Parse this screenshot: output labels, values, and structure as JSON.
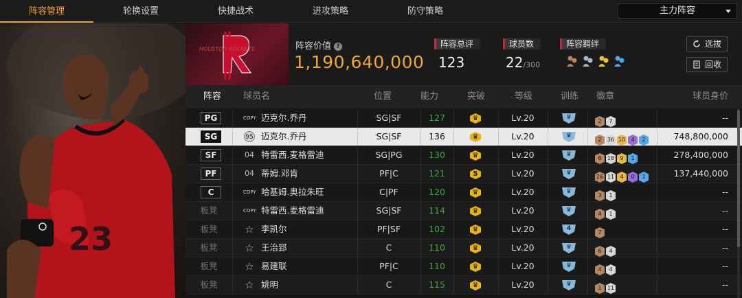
{
  "tabs": [
    {
      "label": "阵容管理",
      "active": true
    },
    {
      "label": "轮换设置",
      "active": false
    },
    {
      "label": "快捷战术",
      "active": false
    },
    {
      "label": "进攻策略",
      "active": false
    },
    {
      "label": "防守策略",
      "active": false
    }
  ],
  "lineup_select": {
    "value": "主力阵容"
  },
  "team": {
    "logo_text": "HOUSTON ROCKETS"
  },
  "header": {
    "value_label": "阵容价值",
    "value": "1,190,640,000",
    "overall_label": "阵容总评",
    "overall": "123",
    "players_label": "球员数",
    "players": "22",
    "players_max": "/300",
    "bonds_label": "阵容羁绊",
    "bond_icons": [
      "bond-bronze-icon",
      "bond-silver-icon",
      "bond-gold-icon",
      "bond-blue-icon"
    ],
    "select_btn": "选拔",
    "recycle_btn": "回收"
  },
  "columns": [
    "阵容",
    "球员名",
    "位置",
    "能力",
    "突破",
    "等级",
    "训练",
    "徽章",
    "球员身价"
  ],
  "rows": [
    {
      "slot": "PG",
      "card": "COPY",
      "name": "迈克尔.乔丹",
      "position": "SG|SF",
      "ability": "127",
      "ability_color": "green",
      "breakthrough": "",
      "level": "Lv.20",
      "training": "",
      "badges": [
        {
          "tier": "bronze",
          "n": "2"
        },
        {
          "tier": "silver",
          "n": "7"
        }
      ],
      "value": "--"
    },
    {
      "slot": "SG",
      "card": "95",
      "name": "迈克尔.乔丹",
      "position": "SG|SF",
      "ability": "136",
      "ability_color": "plain",
      "breakthrough": "",
      "level": "Lv.20",
      "training": "",
      "badges": [
        {
          "tier": "bronze",
          "n": "2"
        },
        {
          "tier": "silver",
          "n": "36"
        },
        {
          "tier": "gold",
          "n": "10"
        },
        {
          "tier": "purple",
          "n": "4"
        },
        {
          "tier": "blue",
          "n": "2"
        }
      ],
      "value": "748,800,000",
      "selected": true
    },
    {
      "slot": "SF",
      "card": "04",
      "name": "特雷西.麦格雷迪",
      "position": "SG|PG",
      "ability": "130",
      "ability_color": "green",
      "breakthrough": "",
      "level": "Lv.20",
      "training": "",
      "badges": [
        {
          "tier": "bronze",
          "n": "6"
        },
        {
          "tier": "silver",
          "n": "18"
        },
        {
          "tier": "gold",
          "n": "9"
        },
        {
          "tier": "blue",
          "n": "1"
        }
      ],
      "value": "278,400,000"
    },
    {
      "slot": "PF",
      "card": "04",
      "name": "蒂姆.邓肯",
      "position": "PF|C",
      "ability": "121",
      "ability_color": "green",
      "breakthrough": "5",
      "level": "Lv.20",
      "training": "",
      "badges": [
        {
          "tier": "bronze",
          "n": "26"
        },
        {
          "tier": "silver",
          "n": "11"
        },
        {
          "tier": "gold",
          "n": "4"
        },
        {
          "tier": "purple",
          "n": "0"
        },
        {
          "tier": "blue",
          "n": "1"
        }
      ],
      "value": "137,440,000"
    },
    {
      "slot": "C",
      "card": "COPY",
      "name": "哈基姆.奥拉朱旺",
      "position": "C|PF",
      "ability": "120",
      "ability_color": "green",
      "breakthrough": "",
      "level": "Lv.20",
      "training": "",
      "badges": [
        {
          "tier": "bronze",
          "n": "3"
        },
        {
          "tier": "silver",
          "n": "1"
        }
      ],
      "value": "--"
    },
    {
      "slot": "板凳",
      "card": "COPY",
      "name": "特雷西.麦格雷迪",
      "position": "SG|SF",
      "ability": "114",
      "ability_color": "green",
      "breakthrough": "",
      "level": "Lv.20",
      "training": "",
      "badges": [
        {
          "tier": "bronze",
          "n": "4"
        },
        {
          "tier": "silver",
          "n": "1"
        }
      ],
      "value": "--"
    },
    {
      "slot": "板凳",
      "card": "star",
      "name": "李凯尔",
      "position": "PF|SF",
      "ability": "102",
      "ability_color": "green",
      "breakthrough": "",
      "level": "Lv.20",
      "training": "4",
      "badges": [
        {
          "tier": "bronze",
          "n": "7"
        }
      ],
      "value": "--"
    },
    {
      "slot": "板凳",
      "card": "star",
      "name": "王治郅",
      "position": "C",
      "ability": "110",
      "ability_color": "green",
      "breakthrough": "",
      "level": "Lv.20",
      "training": "",
      "badges": [
        {
          "tier": "bronze",
          "n": "6"
        },
        {
          "tier": "silver",
          "n": "4"
        }
      ],
      "value": "--"
    },
    {
      "slot": "板凳",
      "card": "star",
      "name": "易建联",
      "position": "PF|C",
      "ability": "110",
      "ability_color": "green",
      "breakthrough": "",
      "level": "Lv.20",
      "training": "",
      "badges": [
        {
          "tier": "bronze",
          "n": "4"
        },
        {
          "tier": "silver",
          "n": "4"
        }
      ],
      "value": "--"
    },
    {
      "slot": "板凳",
      "card": "star",
      "name": "姚明",
      "position": "C",
      "ability": "115",
      "ability_color": "green",
      "breakthrough": "",
      "level": "Lv.20",
      "training": "",
      "badges": [
        {
          "tier": "bronze",
          "n": "1"
        },
        {
          "tier": "silver",
          "n": "11"
        }
      ],
      "value": "--"
    }
  ]
}
